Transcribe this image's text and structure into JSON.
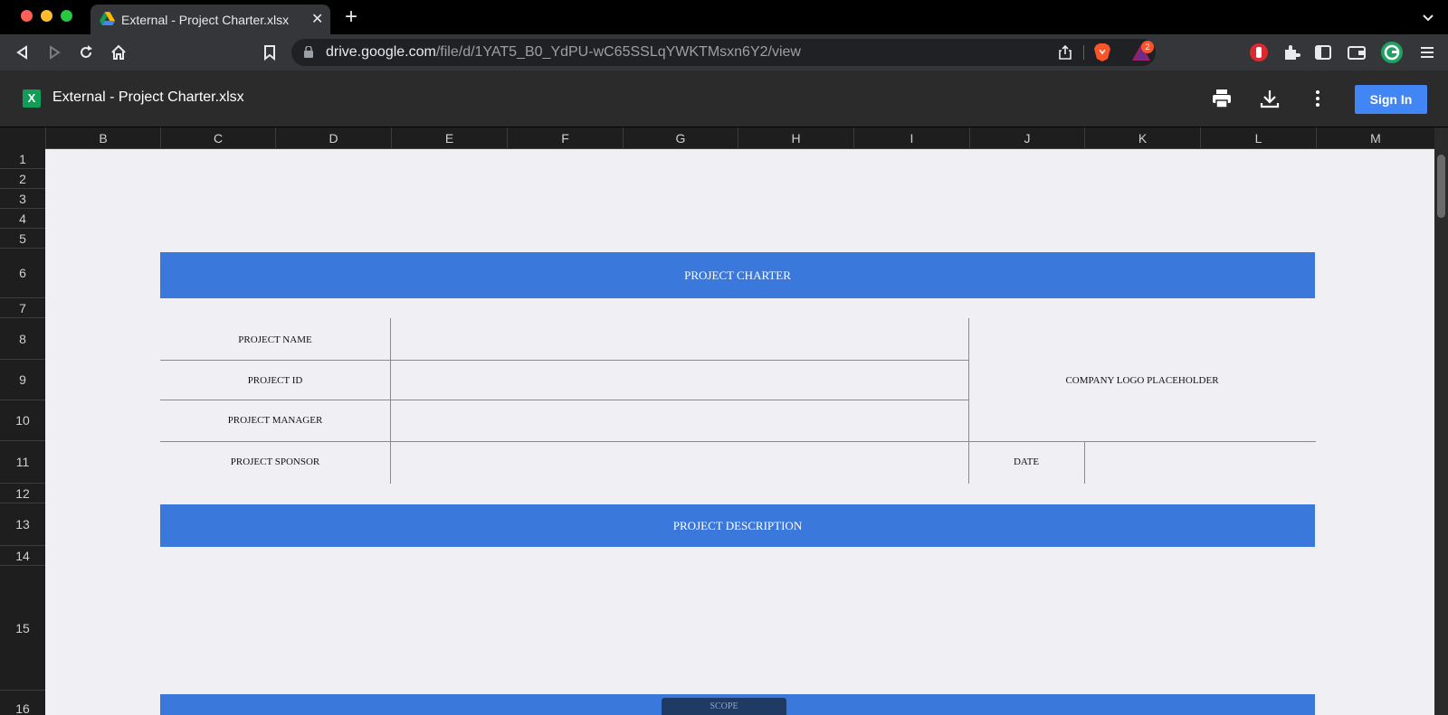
{
  "browser": {
    "tab_title": "External - Project Charter.xlsx",
    "tab_close": "✕",
    "new_tab": "+",
    "url_host": "drive.google.com",
    "url_path": "/file/d/1YAT5_B0_YdPU-wC65SSLqYWKTMsxn6Y2/view",
    "rewards_badge": "2"
  },
  "viewer": {
    "file_icon_letter": "X",
    "title": "External - Project Charter.xlsx",
    "sign_in": "Sign In",
    "icons": [
      "print-icon",
      "download-icon",
      "more-vert-icon"
    ]
  },
  "sheet": {
    "columns": [
      "B",
      "C",
      "D",
      "E",
      "F",
      "G",
      "H",
      "I",
      "J",
      "K",
      "L",
      "M"
    ],
    "rows": [
      "1",
      "2",
      "3",
      "4",
      "5",
      "6",
      "7",
      "8",
      "9",
      "10",
      "11",
      "12",
      "13",
      "14",
      "15",
      "16"
    ],
    "project_charter": "PROJECT CHARTER",
    "project_name": "PROJECT NAME",
    "project_id": "PROJECT ID",
    "project_manager": "PROJECT MANAGER",
    "project_sponsor": "PROJECT SPONSOR",
    "company_logo": "COMPANY LOGO PLACEHOLDER",
    "date": "DATE",
    "project_description": "PROJECT DESCRIPTION",
    "floating_pill_text": "SCOPE"
  },
  "colors": {
    "header_band": "#3b78dc",
    "sign_in": "#4285f4",
    "sheet_bg": "#f0eff4"
  }
}
